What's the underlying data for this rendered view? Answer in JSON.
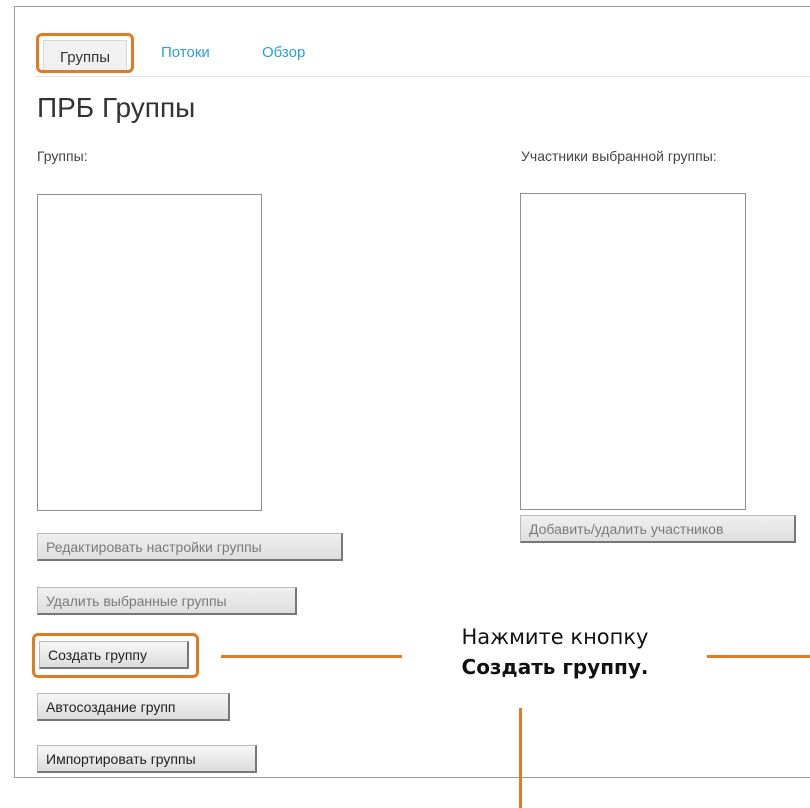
{
  "tabs": {
    "groups": "Группы",
    "flows": "Потоки",
    "overview": "Обзор"
  },
  "page_title": "ПРБ Группы",
  "groups_panel": {
    "label": "Группы:",
    "buttons": {
      "edit": "Редактировать настройки группы",
      "delete": "Удалить выбранные группы",
      "create": "Создать группу",
      "auto_create": "Автосоздание групп",
      "import": "Импортировать группы"
    }
  },
  "members_panel": {
    "label": "Участники выбранной группы:",
    "add_remove_button": "Добавить/удалить участников"
  },
  "callout": {
    "line1": "Нажмите кнопку",
    "line2": "Создать группу."
  },
  "colors": {
    "accent": "#e07b24",
    "link": "#2a9fd6"
  }
}
